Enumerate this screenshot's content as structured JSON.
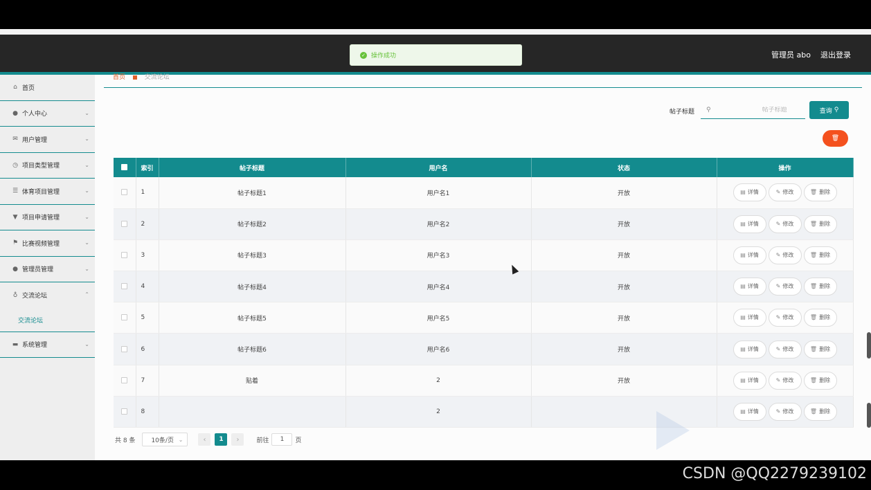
{
  "toast": {
    "message": "操作成功"
  },
  "header": {
    "user": "管理员 abo",
    "logout": "退出登录"
  },
  "sidebar": {
    "items": [
      {
        "label": "首页",
        "icon": "home-icon"
      },
      {
        "label": "个人中心",
        "icon": "user-icon"
      },
      {
        "label": "用户管理",
        "icon": "mail-icon"
      },
      {
        "label": "项目类型管理",
        "icon": "clock-icon"
      },
      {
        "label": "体育项目管理",
        "icon": "sliders-icon"
      },
      {
        "label": "项目申请管理",
        "icon": "cup-icon"
      },
      {
        "label": "比赛视频管理",
        "icon": "flag-icon"
      },
      {
        "label": "管理员管理",
        "icon": "location-icon"
      },
      {
        "label": "交流论坛",
        "icon": "mic-icon"
      }
    ],
    "sub_item": "交流论坛",
    "last_item": {
      "label": "系统管理",
      "icon": "chat-icon"
    }
  },
  "breadcrumb": {
    "home": "首页",
    "current": "交流论坛"
  },
  "search": {
    "label": "帖子标题",
    "placeholder": "帖子标题",
    "button": "查询"
  },
  "table": {
    "headers": [
      "索引",
      "帖子标题",
      "用户名",
      "状态",
      "操作"
    ],
    "rows": [
      {
        "index": "1",
        "title": "帖子标题1",
        "user": "用户名1",
        "status": "开放"
      },
      {
        "index": "2",
        "title": "帖子标题2",
        "user": "用户名2",
        "status": "开放"
      },
      {
        "index": "3",
        "title": "帖子标题3",
        "user": "用户名3",
        "status": "开放"
      },
      {
        "index": "4",
        "title": "帖子标题4",
        "user": "用户名4",
        "status": "开放"
      },
      {
        "index": "5",
        "title": "帖子标题5",
        "user": "用户名5",
        "status": "开放"
      },
      {
        "index": "6",
        "title": "帖子标题6",
        "user": "用户名6",
        "status": "开放"
      },
      {
        "index": "7",
        "title": "贴着",
        "user": "2",
        "status": "开放"
      },
      {
        "index": "8",
        "title": "",
        "user": "2",
        "status": ""
      }
    ],
    "actions": {
      "detail": "详情",
      "edit": "修改",
      "delete": "删除"
    }
  },
  "pager": {
    "total": "共 8 条",
    "size": "10条/页",
    "current": "1",
    "goto": "前往",
    "page_input": "1",
    "page_suffix": "页"
  },
  "watermark": "CSDN @QQ2279239102",
  "colors": {
    "primary": "#138b8e",
    "danger": "#f4511e",
    "header": "#262626"
  }
}
